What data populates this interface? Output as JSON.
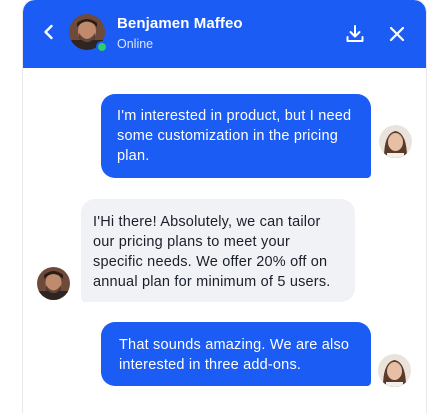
{
  "header": {
    "contact_name": "Benjamen Maffeo",
    "status": "Online",
    "icons": {
      "back": "chevron-left-icon",
      "download": "download-icon",
      "close": "close-icon"
    },
    "colors": {
      "brand": "#1a5cf4",
      "online": "#2ecc71"
    }
  },
  "messages": [
    {
      "direction": "outgoing",
      "text": "I'm interested in product, but I need some customization in the pricing plan."
    },
    {
      "direction": "incoming",
      "text": "I'Hi there! Absolutely, we can tailor our pricing plans to meet your specific needs. We offer 20% off on annual plan for minimum of 5 users."
    },
    {
      "direction": "outgoing",
      "text": "That sounds amazing. We are also interested in three add-ons."
    }
  ]
}
